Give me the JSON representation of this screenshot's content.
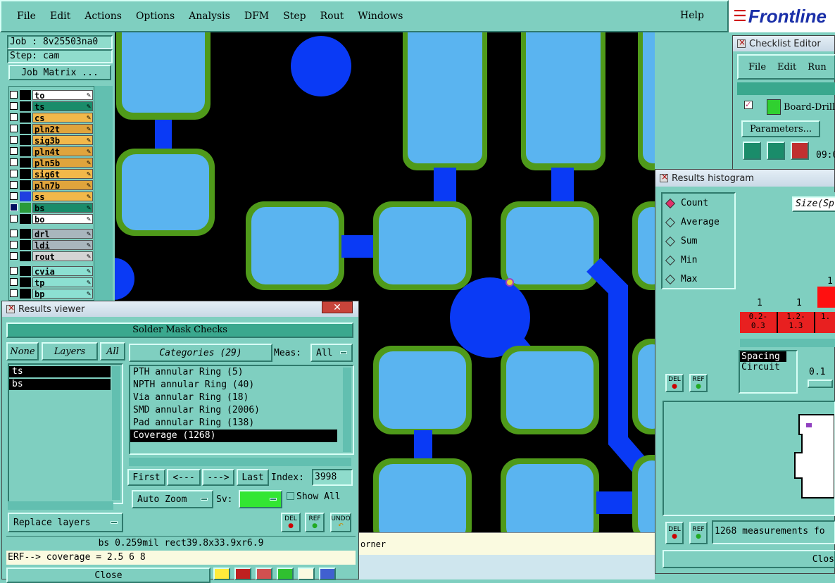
{
  "menu": {
    "items": [
      "File",
      "Edit",
      "Actions",
      "Options",
      "Analysis",
      "DFM",
      "Step",
      "Rout",
      "Windows"
    ],
    "help": "Help",
    "brand": "Frontline"
  },
  "job": {
    "job_label": "Job : 8v25503na0",
    "step_label": "Step: cam",
    "matrix_button": "Job Matrix ..."
  },
  "layers": [
    {
      "name": "to",
      "color": "#ffffff"
    },
    {
      "name": "ts",
      "color": "#1a8c6a"
    },
    {
      "name": "cs",
      "color": "#f2b84a"
    },
    {
      "name": "pln2t",
      "color": "#e0a43c"
    },
    {
      "name": "sig3b",
      "color": "#f2b84a"
    },
    {
      "name": "pln4t",
      "color": "#e0a43c"
    },
    {
      "name": "pln5b",
      "color": "#e0a43c"
    },
    {
      "name": "sig6t",
      "color": "#f2b84a"
    },
    {
      "name": "pln7b",
      "color": "#e0a43c"
    },
    {
      "name": "ss",
      "color": "#f2b84a"
    },
    {
      "name": "bs",
      "color": "#1a8c6a"
    },
    {
      "name": "bo",
      "color": "#ffffff"
    },
    {
      "name": "drl",
      "color": "#a9b6bd"
    },
    {
      "name": "ldi",
      "color": "#a9b6bd"
    },
    {
      "name": "rout",
      "color": "#d4d4d4"
    },
    {
      "name": "cvia",
      "color": "#8ce0d2"
    },
    {
      "name": "tp",
      "color": "#8ce0d2"
    },
    {
      "name": "bp",
      "color": "#8ce0d2"
    }
  ],
  "results_viewer": {
    "title": "Results viewer",
    "header": "Solder Mask Checks",
    "none_btn": "None",
    "layers_btn": "Layers",
    "all_btn": "All",
    "categories_btn": "Categories (29)",
    "meas_label": "Meas:",
    "meas_value": "All",
    "layer_items": [
      "ts",
      "bs"
    ],
    "categories": [
      "PTH annular Ring (5)",
      "NPTH annular Ring (40)",
      "Via annular Ring (18)",
      "SMD annular Ring (2006)",
      "Pad annular Ring (138)",
      "Coverage (1268)"
    ],
    "first_btn": "First",
    "prev_btn": "<---",
    "next_btn": "--->",
    "last_btn": "Last",
    "index_label": "Index:",
    "index_value": "3998",
    "auto_zoom": "Auto Zoom",
    "sv_label": "Sv:",
    "show_all": "Show All",
    "replace_layers": "Replace layers",
    "del": "DEL",
    "ref": "REF",
    "undo": "UNDO",
    "status": "bs 0.259mil  rect39.8x33.9xr6.9",
    "erf": "ERF--> coverage = 2.5 6 8",
    "close": "Close",
    "sv_color": "#33e633"
  },
  "canvas": {
    "status_fragment": "orner"
  },
  "checklist": {
    "title": "Checklist Editor",
    "menu": [
      "File",
      "Edit",
      "Run"
    ],
    "item": "Board-Drill",
    "params_btn": "Parameters...",
    "time": "09:0"
  },
  "histogram": {
    "title": "Results histogram",
    "options": [
      "Count",
      "Average",
      "Sum",
      "Min",
      "Max"
    ],
    "selected": "Count",
    "size_label": "Size(Sp",
    "counts": [
      "1",
      "1",
      "1"
    ],
    "bins": [
      "0.2-\n0.3",
      "1.2-\n1.3",
      "1."
    ],
    "list": [
      "Spacing",
      "Circuit"
    ],
    "axis_val": "0.1",
    "del": "DEL",
    "ref": "REF",
    "measurements": "1268 measurements fo",
    "close": "Clos"
  }
}
